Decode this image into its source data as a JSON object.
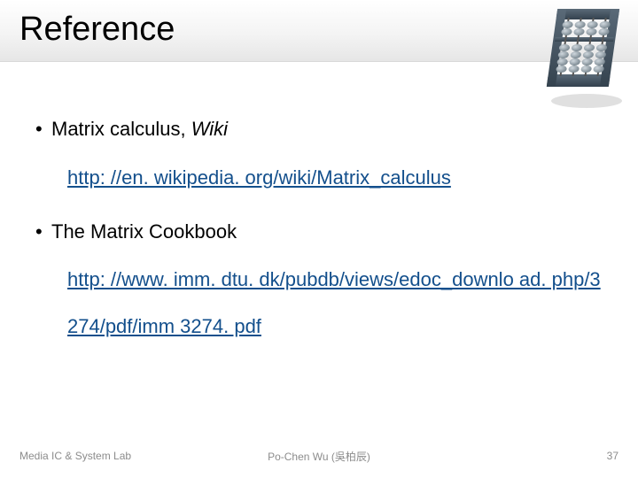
{
  "header": {
    "title": "Reference"
  },
  "refs": [
    {
      "label_prefix": "Matrix calculus, ",
      "label_italic": "Wiki",
      "url": "http: //en. wikipedia. org/wiki/Matrix_calculus"
    },
    {
      "label_prefix": "The Matrix Cookbook",
      "label_italic": "",
      "url": "http: //www. imm. dtu. dk/pubdb/views/edoc_downlo ad. php/3274/pdf/imm 3274. pdf"
    }
  ],
  "footer": {
    "left": "Media IC & System Lab",
    "center": "Po-Chen Wu (吳柏辰)",
    "right": "37"
  },
  "glyphs": {
    "bullet": "•"
  }
}
